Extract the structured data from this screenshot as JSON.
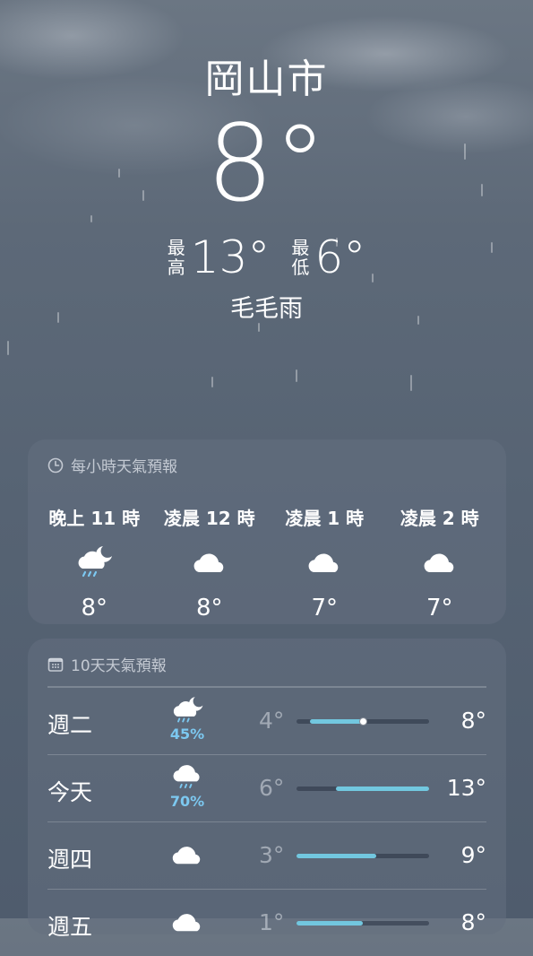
{
  "location": {
    "city": "岡山市",
    "current_temp": "8°",
    "condition": "毛毛雨"
  },
  "high_low": {
    "high_label": [
      "最",
      "高"
    ],
    "high_value": "13°",
    "low_label": [
      "最",
      "低"
    ],
    "low_value": "6°"
  },
  "hourly": {
    "header": "每小時天氣預報",
    "header_icon": "clock-icon",
    "items": [
      {
        "time": "晚上 11 時",
        "icon": "cloud-moon-rain-icon",
        "temp": "8°"
      },
      {
        "time": "凌晨 12 時",
        "icon": "cloud-icon",
        "temp": "8°"
      },
      {
        "time": "凌晨 1 時",
        "icon": "cloud-icon",
        "temp": "7°"
      },
      {
        "time": "凌晨 2 時",
        "icon": "cloud-icon",
        "temp": "7°"
      }
    ]
  },
  "daily": {
    "header": "10天天氣預報",
    "header_icon": "calendar-icon",
    "range_min": 3,
    "range_max": 13,
    "items": [
      {
        "day": "週二",
        "icon": "cloud-moon-rain-icon",
        "precip": "45%",
        "low": "4°",
        "high": "8°",
        "low_value": 4,
        "high_value": 8,
        "current_value": 8
      },
      {
        "day": "今天",
        "icon": "cloud-rain-icon",
        "precip": "70%",
        "low": "6°",
        "high": "13°",
        "low_value": 6,
        "high_value": 13
      },
      {
        "day": "週四",
        "icon": "cloud-icon",
        "precip": "",
        "low": "3°",
        "high": "9°",
        "low_value": 3,
        "high_value": 9
      },
      {
        "day": "週五",
        "icon": "cloud-icon",
        "precip": "",
        "low": "1°",
        "high": "8°",
        "low_value": 1,
        "high_value": 8
      }
    ]
  },
  "colors": {
    "precip": "#7cc8f0",
    "range_bar": "#72c7df"
  }
}
